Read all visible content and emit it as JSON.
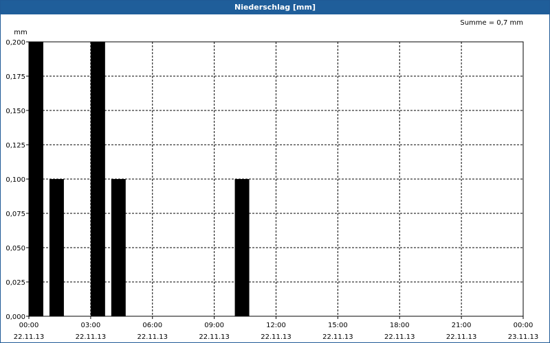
{
  "window": {
    "title": "Niederschlag [mm]"
  },
  "chart_data": {
    "type": "bar",
    "title": "Niederschlag [mm]",
    "ylabel": "mm",
    "summary": "Summe = 0,7 mm",
    "ylim": [
      0,
      0.2
    ],
    "yticks": [
      0,
      0.025,
      0.05,
      0.075,
      0.1,
      0.125,
      0.15,
      0.175,
      0.2
    ],
    "ytick_labels": [
      "0,000",
      "0,025",
      "0,050",
      "0,075",
      "0,100",
      "0,125",
      "0,150",
      "0,175",
      "0,200"
    ],
    "xlim_hours": [
      0,
      24
    ],
    "xticks": [
      {
        "hour": 0,
        "time": "00:00",
        "date": "22.11.13"
      },
      {
        "hour": 3,
        "time": "03:00",
        "date": "22.11.13"
      },
      {
        "hour": 6,
        "time": "06:00",
        "date": "22.11.13"
      },
      {
        "hour": 9,
        "time": "09:00",
        "date": "22.11.13"
      },
      {
        "hour": 12,
        "time": "12:00",
        "date": "22.11.13"
      },
      {
        "hour": 15,
        "time": "15:00",
        "date": "22.11.13"
      },
      {
        "hour": 18,
        "time": "18:00",
        "date": "22.11.13"
      },
      {
        "hour": 21,
        "time": "21:00",
        "date": "22.11.13"
      },
      {
        "hour": 24,
        "time": "00:00",
        "date": "23.11.13"
      }
    ],
    "bars": [
      {
        "start_hour": 0.0,
        "end_hour": 0.7,
        "value": 0.2
      },
      {
        "start_hour": 1.0,
        "end_hour": 1.7,
        "value": 0.1
      },
      {
        "start_hour": 3.0,
        "end_hour": 3.7,
        "value": 0.2
      },
      {
        "start_hour": 4.0,
        "end_hour": 4.7,
        "value": 0.1
      },
      {
        "start_hour": 10.0,
        "end_hour": 10.7,
        "value": 0.1
      }
    ],
    "grid": true,
    "bar_color": "#000000",
    "grid_color": "#000000"
  }
}
